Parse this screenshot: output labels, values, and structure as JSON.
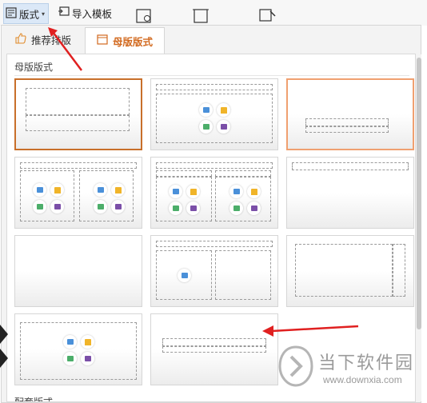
{
  "toolbar": {
    "layout_label": "版式",
    "import_label": "导入模板"
  },
  "tabs": {
    "recommend": "推荐排版",
    "master": "母版版式"
  },
  "section": {
    "title": "母版版式",
    "next_title": "配套版式"
  },
  "watermark": {
    "name": "当下软件园",
    "url": "www.downxia.com"
  },
  "colors": {
    "accent": "#c86f2a",
    "annotation": "#e02020"
  }
}
